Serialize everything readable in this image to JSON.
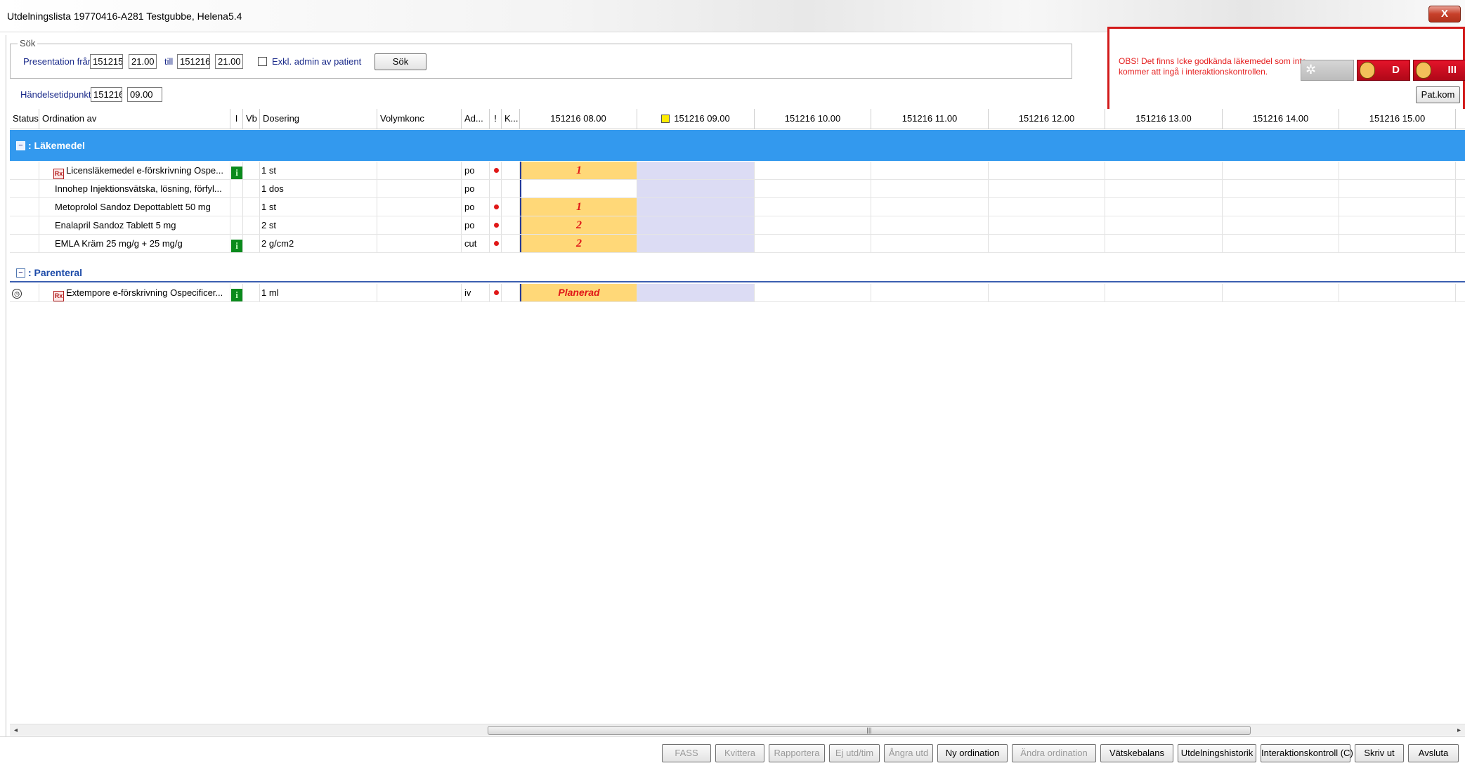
{
  "window": {
    "title": "Utdelningslista  19770416-A281 Testgubbe, Helena5.4",
    "close_label": "X"
  },
  "search": {
    "group_label": "Sök",
    "presentation_label": "Presentation från",
    "from_date": "151215",
    "from_time": "21.00",
    "till_label": "till",
    "to_date": "151216",
    "to_time": "21.00",
    "exclude_label": "Exkl. admin av patient",
    "sok_button": "Sök",
    "event_label": "Händelsetidpunkt",
    "event_date": "151216",
    "event_time": "09.00"
  },
  "warning": {
    "text": "OBS! Det finns Icke godkända läkemedel som inte kommer att ingå i interaktionskontrollen.",
    "badge_d": "D",
    "badge_iii": "III",
    "patkom_label": "Pat.kom",
    "colors": {
      "border": "#d21a1a",
      "text": "#e52020",
      "badge": "#c8101f"
    }
  },
  "grid": {
    "columns": {
      "status": "Status",
      "ordination": "Ordination av",
      "i": "I",
      "vb": "Vb",
      "dosering": "Dosering",
      "volym": "Volymkonc",
      "ad": "Ad...",
      "excl": "!",
      "k": "K..."
    },
    "time_columns": [
      "151216 08.00",
      "151216 09.00",
      "151216 10.00",
      "151216 11.00",
      "151216 12.00",
      "151216 13.00",
      "151216 14.00",
      "151216 15.00"
    ],
    "groups": {
      "lakemedel": ": Läkemedel",
      "parenteral": ": Parenteral"
    },
    "rows_lakemedel": [
      {
        "name": "Licensläkemedel e-förskrivning Ospe...",
        "dose": "1 st",
        "route": "po",
        "slot": "1"
      },
      {
        "name": "Innohep Injektionsvätska, lösning, förfyl...",
        "dose": "1 dos",
        "route": "po",
        "slot": ""
      },
      {
        "name": "Metoprolol Sandoz Depottablett 50 mg",
        "dose": "1 st",
        "route": "po",
        "slot": "1"
      },
      {
        "name": "Enalapril Sandoz Tablett 5 mg",
        "dose": "2 st",
        "route": "po",
        "slot": "2"
      },
      {
        "name": "EMLA Kräm 25 mg/g + 25 mg/g",
        "dose": "2 g/cm2",
        "route": "cut",
        "slot": "2"
      }
    ],
    "rows_parenteral": [
      {
        "name": "Extempore e-förskrivning Ospecificer...",
        "dose": "1 ml",
        "route": "iv",
        "slot": "Planerad"
      }
    ],
    "colors": {
      "group_selected": "#3399ee",
      "slot_due": "#ffd878",
      "slot_current": "#dcdcf4",
      "slot_text": "#e01818"
    }
  },
  "buttons": {
    "fass": "FASS",
    "kvittera": "Kvittera",
    "rapportera": "Rapportera",
    "ej_utd": "Ej utd/tim",
    "angra_utd": "Ångra utd",
    "ny_ordination": "Ny ordination",
    "andra_ordination": "Ändra ordination",
    "vatskebalans": "Vätskebalans",
    "utdelningshistorik": "Utdelningshistorik",
    "interaktionskontroll": "Interaktionskontroll (C)",
    "skriv_ut": "Skriv ut",
    "avsluta": "Avsluta"
  },
  "icons": {
    "info": "info-icon",
    "prescription": "prescription-icon",
    "clock": "clock-icon",
    "marker": "yellow-marker-icon"
  }
}
